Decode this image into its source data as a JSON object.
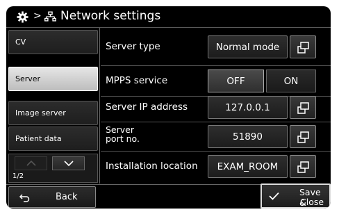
{
  "header": {
    "separator": ">",
    "title": "Network settings",
    "icons": [
      "gear-icon",
      "network-icon"
    ]
  },
  "sidebar": {
    "items": [
      {
        "label": "CV",
        "selected": false
      },
      {
        "label": "Server",
        "selected": true
      },
      {
        "label": "Image server",
        "selected": false
      },
      {
        "label": "Patient data",
        "selected": false
      }
    ],
    "page_indicator": "1/2"
  },
  "settings": {
    "server_type": {
      "label": "Server type",
      "value": "Normal mode"
    },
    "mpps_service": {
      "label": "MPPS service",
      "off_label": "OFF",
      "on_label": "ON",
      "selected": "OFF"
    },
    "server_ip": {
      "label": "Server IP address",
      "value": "127.0.0.1"
    },
    "server_port": {
      "label_line1": "Server",
      "label_line2": "port no.",
      "value": "51890"
    },
    "installation_location": {
      "label": "Installation location",
      "value": "EXAM_ROOM"
    }
  },
  "footer": {
    "back_label": "Back",
    "save_line1": "Save &",
    "save_line2": "Close"
  },
  "colors": {
    "background": "#000000",
    "selected_item": "#d8d8d8",
    "text": "#ffffff"
  }
}
